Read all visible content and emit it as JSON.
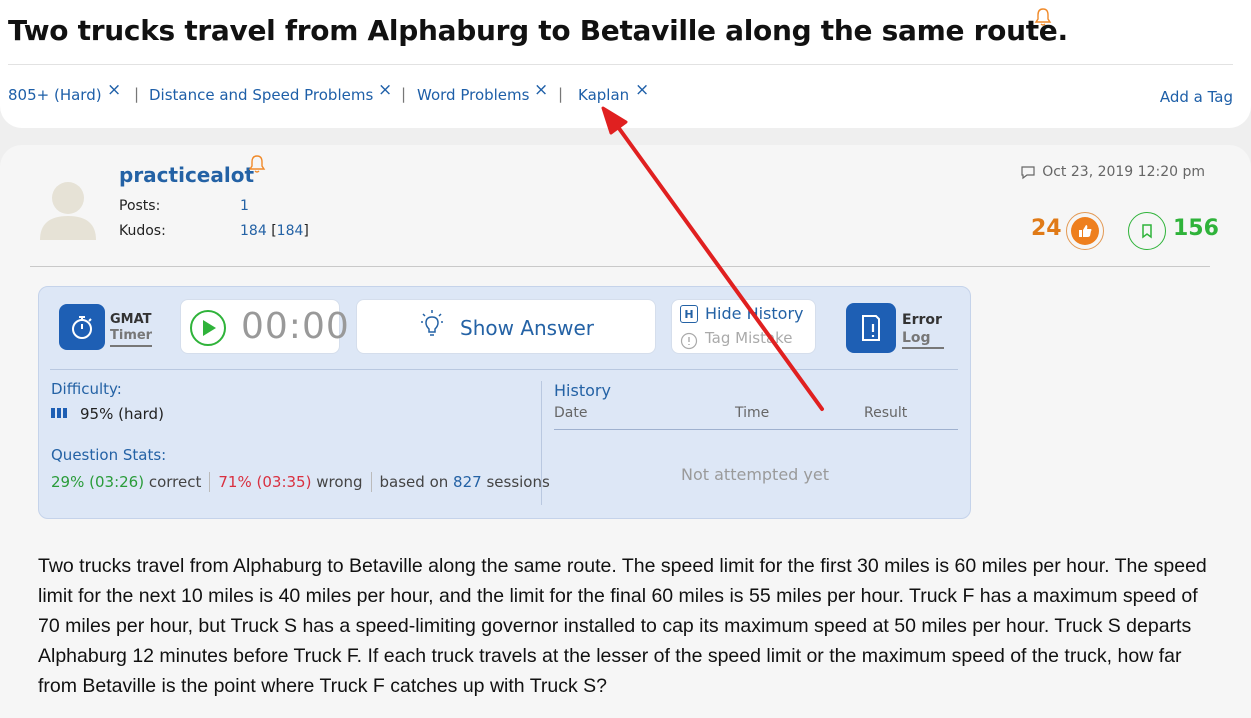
{
  "question_title": "Two trucks travel from Alphaburg to Betaville along the same route.",
  "tags": {
    "items": [
      {
        "label": "805+ (Hard)"
      },
      {
        "label": "Distance and Speed Problems"
      },
      {
        "label": "Word Problems"
      },
      {
        "label": "Kaplan"
      }
    ],
    "remove_glyph": "×",
    "separator": "|",
    "add_label": "Add a Tag"
  },
  "post": {
    "username": "practicealot",
    "posts_label": "Posts:",
    "posts_value": "1",
    "kudos_label": "Kudos:",
    "kudos_value": "184",
    "kudos_bracket": "184",
    "date": "Oct 23, 2019 12:20 pm",
    "kudos_count": "24",
    "bookmark_count": "156"
  },
  "panel": {
    "gmat_label": "GMAT",
    "timer_label": "Timer",
    "timer_value": "00:00",
    "show_answer_label": "Show Answer",
    "hide_history_key": "H",
    "hide_history_label": "Hide History",
    "tag_mistake_label": "Tag Mistake",
    "error_label": "Error",
    "log_label": "Log",
    "difficulty_label": "Difficulty:",
    "difficulty_value": "95% (hard)",
    "stats_label": "Question Stats:",
    "correct_pct": "29%",
    "correct_time": "(03:26)",
    "correct_word": "correct",
    "wrong_pct": "71%",
    "wrong_time": "(03:35)",
    "wrong_word": "wrong",
    "based_on": "based on",
    "sessions_count": "827",
    "sessions_word": "sessions",
    "history_label": "History",
    "history_cols": [
      "Date",
      "Time",
      "Result"
    ],
    "history_empty": "Not attempted yet"
  },
  "question_text": "Two trucks travel from Alphaburg to Betaville along the same route. The speed limit for the first 30 miles is 60 miles per hour. The speed limit for the next 10 miles is 40 miles per hour, and the limit for the final 60 miles is 55 miles per hour. Truck F has a maximum speed of 70 miles per hour, but Truck S has a speed-limiting governor installed to cap its maximum speed at 50 miles per hour. Truck S departs Alphaburg 12 minutes before Truck F. If each truck travels at the lesser of the speed limit or the maximum speed of the truck, how far from Betaville is the point where Truck F catches up with Truck S?",
  "colors": {
    "link_blue": "#2462a5",
    "kudos_orange": "#e07a17",
    "bookmark_green": "#2fb33a",
    "panel_bg": "#dde7f6",
    "annotation_red": "#e02020"
  }
}
